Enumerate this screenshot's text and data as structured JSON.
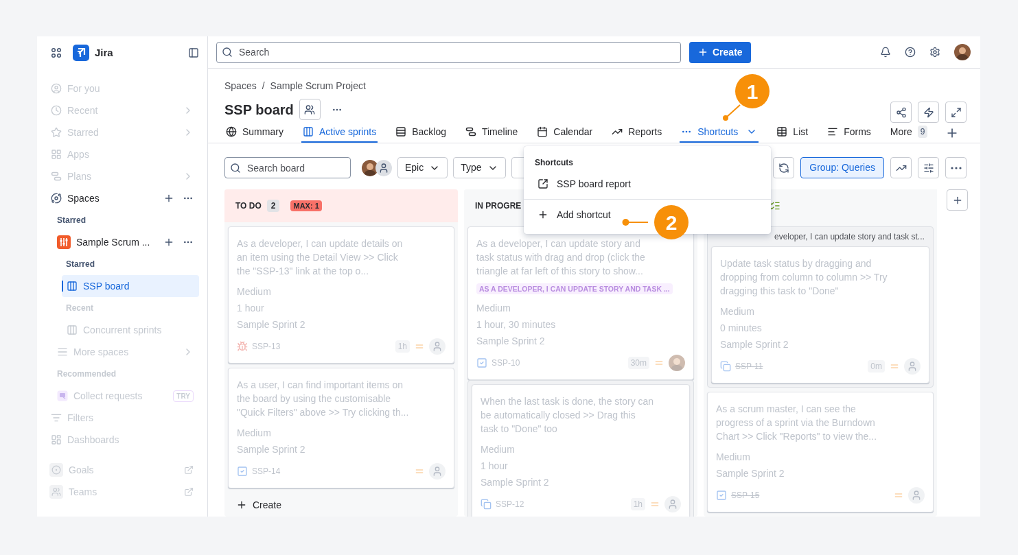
{
  "topbar": {
    "search": {
      "placeholder": "Search"
    },
    "create": "Create"
  },
  "sidebar": {
    "app": "Jira",
    "items": [
      {
        "kind": "item",
        "label": "For you",
        "dimmed": true,
        "selected": false
      },
      {
        "kind": "item",
        "label": "Recent",
        "dimmed": true,
        "selected": false,
        "chevron": true
      },
      {
        "kind": "item",
        "label": "Starred",
        "dimmed": true,
        "selected": false,
        "chevron": true
      },
      {
        "kind": "item",
        "label": "Apps",
        "dimmed": true,
        "selected": false
      },
      {
        "kind": "item",
        "label": "Plans",
        "dimmed": true,
        "selected": false,
        "chevron": true
      },
      {
        "kind": "item",
        "label": "Spaces",
        "dimmed": false,
        "selected": false,
        "actions": true,
        "children": [
          {
            "kind": "heading",
            "label": "Starred",
            "dimmed": false
          },
          {
            "kind": "project",
            "label": "Sample Scrum ...",
            "dimmed": false,
            "selected": false,
            "actions": true,
            "children": [
              {
                "kind": "heading",
                "label": "Starred",
                "dimmed": false
              },
              {
                "kind": "item",
                "label": "SSP board",
                "dimmed": false,
                "selected": true
              },
              {
                "kind": "heading",
                "label": "Recent",
                "dimmed": true
              },
              {
                "kind": "item",
                "label": "Concurrent sprints",
                "dimmed": true,
                "selected": false
              }
            ]
          },
          {
            "kind": "item",
            "label": "More spaces",
            "dimmed": true,
            "selected": false,
            "chevron": true
          },
          {
            "kind": "heading",
            "label": "Recommended",
            "dimmed": true
          },
          {
            "kind": "item",
            "label": "Collect requests",
            "dimmed": true,
            "selected": false,
            "badge": "TRY"
          }
        ]
      },
      {
        "kind": "item",
        "label": "Filters",
        "dimmed": true,
        "selected": false
      },
      {
        "kind": "item",
        "label": "Dashboards",
        "dimmed": true,
        "selected": false
      },
      {
        "kind": "item",
        "label": "Goals",
        "dimmed": true,
        "selected": false,
        "external": true
      },
      {
        "kind": "item",
        "label": "Teams",
        "dimmed": true,
        "selected": false,
        "external": true
      }
    ]
  },
  "header": {
    "breadcrumbs": [
      "Spaces",
      "Sample Scrum Project"
    ],
    "separator": "/",
    "title": "SSP board"
  },
  "tabs": [
    {
      "label": "Summary",
      "selected": false
    },
    {
      "label": "Active sprints",
      "selected": true
    },
    {
      "label": "Backlog",
      "selected": false
    },
    {
      "label": "Timeline",
      "selected": false
    },
    {
      "label": "Calendar",
      "selected": false
    },
    {
      "label": "Reports",
      "selected": false
    },
    {
      "label": "Shortcuts",
      "selected": true
    },
    {
      "label": "List",
      "selected": false
    },
    {
      "label": "Forms",
      "selected": false
    },
    {
      "label": "More",
      "selected": false,
      "count": "9"
    }
  ],
  "toolbar": {
    "search": {
      "placeholder": "Search board"
    },
    "people": [
      {
        "kind": "photo"
      },
      {
        "kind": "empty"
      }
    ],
    "filters": [
      "Epic",
      "Type"
    ],
    "group": {
      "label": "Group: Queries",
      "selected": true
    }
  },
  "board": {
    "dimmed": true,
    "columns": [
      {
        "kind": "todo",
        "title": "TO DO",
        "count": "2",
        "limit": "MAX: 1",
        "over_limit": true,
        "create": "Create",
        "items": [
          {
            "kind": "card",
            "summary": "As a developer, I can update details on an item using the Detail View >> Click the \"SSP-13\" link at the top o...",
            "priority": "Medium",
            "estimate": "1 hour",
            "sprint": "Sample Sprint 2",
            "issue_type": {
              "kind": "bug"
            },
            "key": "SSP-13",
            "done": false,
            "time": "1h",
            "assignee": {
              "kind": "empty"
            }
          },
          {
            "kind": "card",
            "summary": "As a user, I can find important items on the board by using the customisable \"Quick Filters\" above >> Try clicking th...",
            "priority": "Medium",
            "sprint": "Sample Sprint 2",
            "issue_type": {
              "kind": "task"
            },
            "key": "SSP-14",
            "done": false,
            "assignee": {
              "kind": "empty"
            }
          }
        ]
      },
      {
        "kind": "progress",
        "title": "IN PROGRE",
        "over_limit": false,
        "items": [
          {
            "kind": "card",
            "summary": "As a developer, I can update story and task status with drag and drop (click the triangle at far left of this story to show...",
            "epic": "AS A DEVELOPER, I CAN UPDATE STORY AND TASK ...",
            "priority": "Medium",
            "estimate": "1 hour, 30 minutes",
            "sprint": "Sample Sprint 2",
            "issue_type": {
              "kind": "task"
            },
            "key": "SSP-10",
            "done": false,
            "time": "30m",
            "assignee": {
              "kind": "photo"
            }
          },
          {
            "kind": "group",
            "cards": [
              {
                "kind": "card",
                "summary": "When the last task is done, the story can be automatically closed >> Drag this task to \"Done\" too",
                "priority": "Medium",
                "estimate": "1 hour",
                "sprint": "Sample Sprint 2",
                "issue_type": {
                  "kind": "subtask"
                },
                "key": "SSP-12",
                "done": false,
                "time": "1h",
                "assignee": {
                  "kind": "empty"
                }
              }
            ]
          }
        ]
      },
      {
        "kind": "done",
        "over_limit": false,
        "items": [
          {
            "kind": "group",
            "title": "eveloper, I can update story and task st...",
            "cards": [
              {
                "kind": "card",
                "summary": "Update task status by dragging and dropping from column to column >> Try dragging this task to \"Done\"",
                "priority": "Medium",
                "estimate": "0 minutes",
                "sprint": "Sample Sprint 2",
                "issue_type": {
                  "kind": "subtask"
                },
                "key": "SSP-11",
                "done": true,
                "time": "0m",
                "assignee": {
                  "kind": "empty"
                }
              }
            ]
          },
          {
            "kind": "card",
            "summary": "As a scrum master, I can see the progress of a sprint via the Burndown Chart >> Click \"Reports\" to view the...",
            "priority": "Medium",
            "sprint": "Sample Sprint 2",
            "issue_type": {
              "kind": "task"
            },
            "key": "SSP-15",
            "done": true,
            "assignee": {
              "kind": "empty"
            }
          }
        ]
      }
    ]
  },
  "menu": {
    "title": "Shortcuts",
    "items": [
      {
        "kind": "link",
        "label": "SSP board report"
      },
      {
        "kind": "add",
        "label": "Add shortcut"
      }
    ]
  },
  "callouts": [
    {
      "label": "1"
    },
    {
      "label": "2"
    }
  ]
}
